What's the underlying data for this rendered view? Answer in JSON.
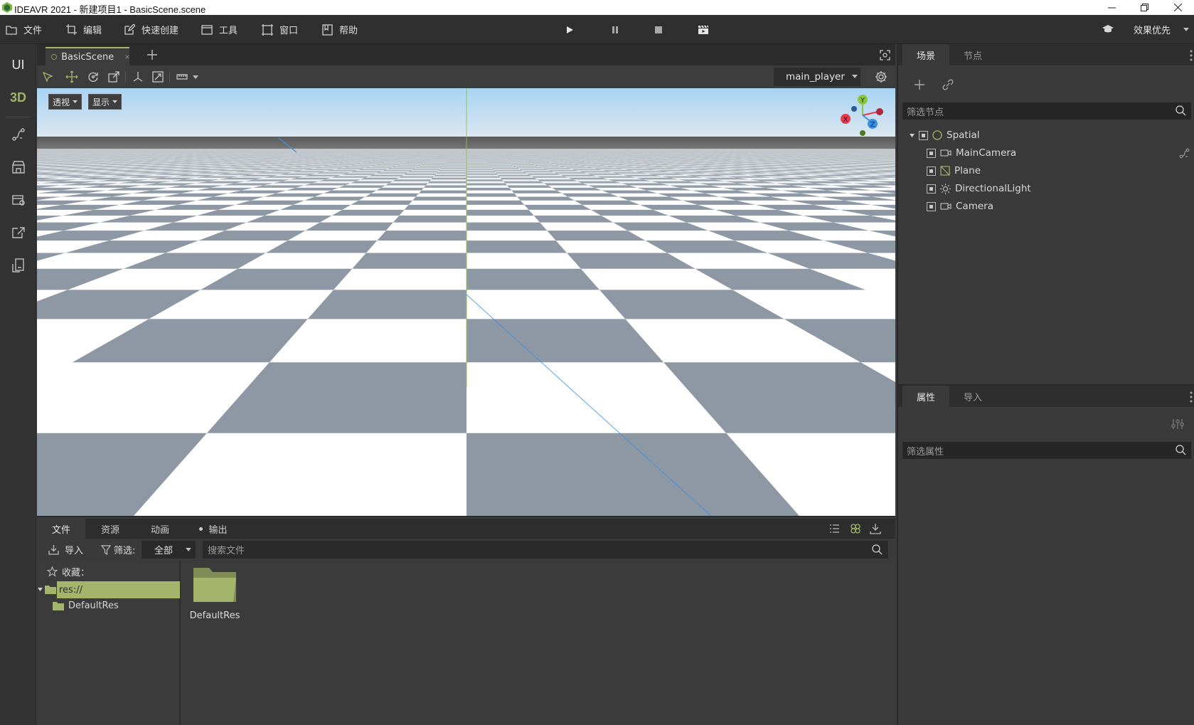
{
  "window": {
    "title": "IDEAVR 2021 - 新建项目1 - BasicScene.scene",
    "icons": {
      "app": "ideavr-logo-icon",
      "minimize": "minimize-icon",
      "maximize": "restore-icon",
      "close": "close-icon"
    }
  },
  "menu": {
    "items": [
      {
        "label": "文件",
        "icon": "folder-icon"
      },
      {
        "label": "编辑",
        "icon": "crop-icon"
      },
      {
        "label": "快速创建",
        "icon": "edit-icon"
      },
      {
        "label": "工具",
        "icon": "window-icon"
      },
      {
        "label": "窗口",
        "icon": "frame-icon"
      },
      {
        "label": "帮助",
        "icon": "book-icon"
      }
    ],
    "controls": [
      "play-icon",
      "pause-icon",
      "stop-icon",
      "clapper-icon"
    ],
    "right": {
      "quality_label": "效果优先",
      "icon": "graduation-cap-icon"
    }
  },
  "sidebar": {
    "mode_ui": "UI",
    "mode_3d": "3D",
    "tools": [
      "path-icon",
      "store-icon",
      "package-icon",
      "export-icon",
      "device-icon"
    ]
  },
  "editor": {
    "tab_label": "BasicScene",
    "player_select": "main_player",
    "view_mode": "透视",
    "display_mode": "显示",
    "gizmo": {
      "x": "X",
      "y": "Y",
      "z": "Z"
    }
  },
  "bottom": {
    "tabs": [
      "文件",
      "资源",
      "动画",
      "输出"
    ],
    "import_label": "导入",
    "filter_label": "筛选:",
    "filter_value": "全部",
    "search_placeholder": "搜索文件",
    "favorites_label": "收藏：",
    "tree_root": "res://",
    "tree_child": "DefaultRes",
    "files": [
      {
        "name": "DefaultRes",
        "type": "folder"
      }
    ]
  },
  "scene_panel": {
    "tabs": [
      "场景",
      "节点"
    ],
    "filter_placeholder": "筛选节点",
    "root_node": "Spatial",
    "nodes": [
      "MainCamera",
      "Plane",
      "DirectionalLight",
      "Camera"
    ]
  },
  "inspector": {
    "tabs": [
      "属性",
      "导入"
    ],
    "filter_placeholder": "筛选属性"
  },
  "colors": {
    "accent": "#a4b46a",
    "folder": "#a4b46a",
    "checker_dark": "#8d98a4",
    "checker_light": "#ffffff",
    "axis_x": "#e8384f",
    "axis_y": "#8cc63e",
    "axis_z": "#3a8fe0"
  }
}
